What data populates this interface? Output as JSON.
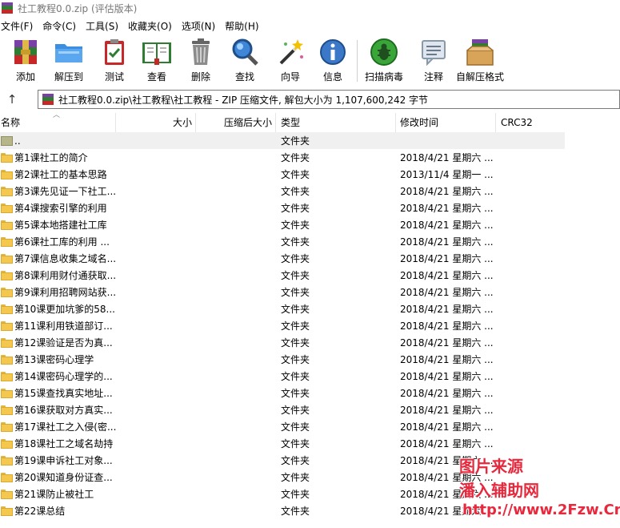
{
  "window": {
    "title": "社工教程0.0.zip (评估版本)"
  },
  "menu": [
    {
      "label": "文件(F)"
    },
    {
      "label": "命令(C)"
    },
    {
      "label": "工具(S)"
    },
    {
      "label": "收藏夹(O)"
    },
    {
      "label": "选项(N)"
    },
    {
      "label": "帮助(H)"
    }
  ],
  "toolbar": {
    "add": "添加",
    "extract_to": "解压到",
    "test": "测试",
    "view": "查看",
    "delete": "删除",
    "find": "查找",
    "wizard": "向导",
    "info": "信息",
    "virus_scan": "扫描病毒",
    "comment": "注释",
    "sfx": "自解压格式"
  },
  "address": {
    "path": "社工教程0.0.zip\\社工教程\\社工教程 - ZIP 压缩文件, 解包大小为 1,107,600,242 字节"
  },
  "columns": {
    "name": "名称",
    "size": "大小",
    "packed": "压缩后大小",
    "type": "类型",
    "modified": "修改时间",
    "crc": "CRC32"
  },
  "files": [
    {
      "name": "..",
      "type": "文件夹",
      "date": ""
    },
    {
      "name": "第1课社工的简介",
      "type": "文件夹",
      "date": "2018/4/21 星期六 ..."
    },
    {
      "name": "第2课社工的基本思路",
      "type": "文件夹",
      "date": "2013/11/4 星期一 ..."
    },
    {
      "name": "第3课先见证一下社工...",
      "type": "文件夹",
      "date": "2018/4/21 星期六 ..."
    },
    {
      "name": "第4课搜索引擎的利用",
      "type": "文件夹",
      "date": "2018/4/21 星期六 ..."
    },
    {
      "name": "第5课本地搭建社工库",
      "type": "文件夹",
      "date": "2018/4/21 星期六 ..."
    },
    {
      "name": "第6课社工库的利用 ...",
      "type": "文件夹",
      "date": "2018/4/21 星期六 ..."
    },
    {
      "name": "第7课信息收集之域名...",
      "type": "文件夹",
      "date": "2018/4/21 星期六 ..."
    },
    {
      "name": "第8课利用财付通获取...",
      "type": "文件夹",
      "date": "2018/4/21 星期六 ..."
    },
    {
      "name": "第9课利用招聘网站获...",
      "type": "文件夹",
      "date": "2018/4/21 星期六 ..."
    },
    {
      "name": "第10课更加坑爹的58...",
      "type": "文件夹",
      "date": "2018/4/21 星期六 ..."
    },
    {
      "name": "第11课利用铁道部订...",
      "type": "文件夹",
      "date": "2018/4/21 星期六 ..."
    },
    {
      "name": "第12课验证是否为真...",
      "type": "文件夹",
      "date": "2018/4/21 星期六 ..."
    },
    {
      "name": "第13课密码心理学",
      "type": "文件夹",
      "date": "2018/4/21 星期六 ..."
    },
    {
      "name": "第14课密码心理学的...",
      "type": "文件夹",
      "date": "2018/4/21 星期六 ..."
    },
    {
      "name": "第15课查找真实地址...",
      "type": "文件夹",
      "date": "2018/4/21 星期六 ..."
    },
    {
      "name": "第16课获取对方真实...",
      "type": "文件夹",
      "date": "2018/4/21 星期六 ..."
    },
    {
      "name": "第17课社工之入侵(密...",
      "type": "文件夹",
      "date": "2018/4/21 星期六 ..."
    },
    {
      "name": "第18课社工之域名劫持",
      "type": "文件夹",
      "date": "2018/4/21 星期六 ..."
    },
    {
      "name": "第19课申诉社工对象...",
      "type": "文件夹",
      "date": "2018/4/21 星期六 ..."
    },
    {
      "name": "第20课知道身份证查...",
      "type": "文件夹",
      "date": "2018/4/21 星期六 ..."
    },
    {
      "name": "第21课防止被社工",
      "type": "文件夹",
      "date": "2018/4/21 星期六 ..."
    },
    {
      "name": "第22课总结",
      "type": "文件夹",
      "date": "2018/4/21 星期六 ..."
    }
  ],
  "watermark": {
    "line1": "图片来源",
    "line2": "潘入辅助网",
    "line3": "http://www.2Fzw.Cn"
  },
  "colors": {
    "watermark": "#e8283c",
    "folder": "#f4c84f",
    "parent_row": "#f0f0f0"
  }
}
